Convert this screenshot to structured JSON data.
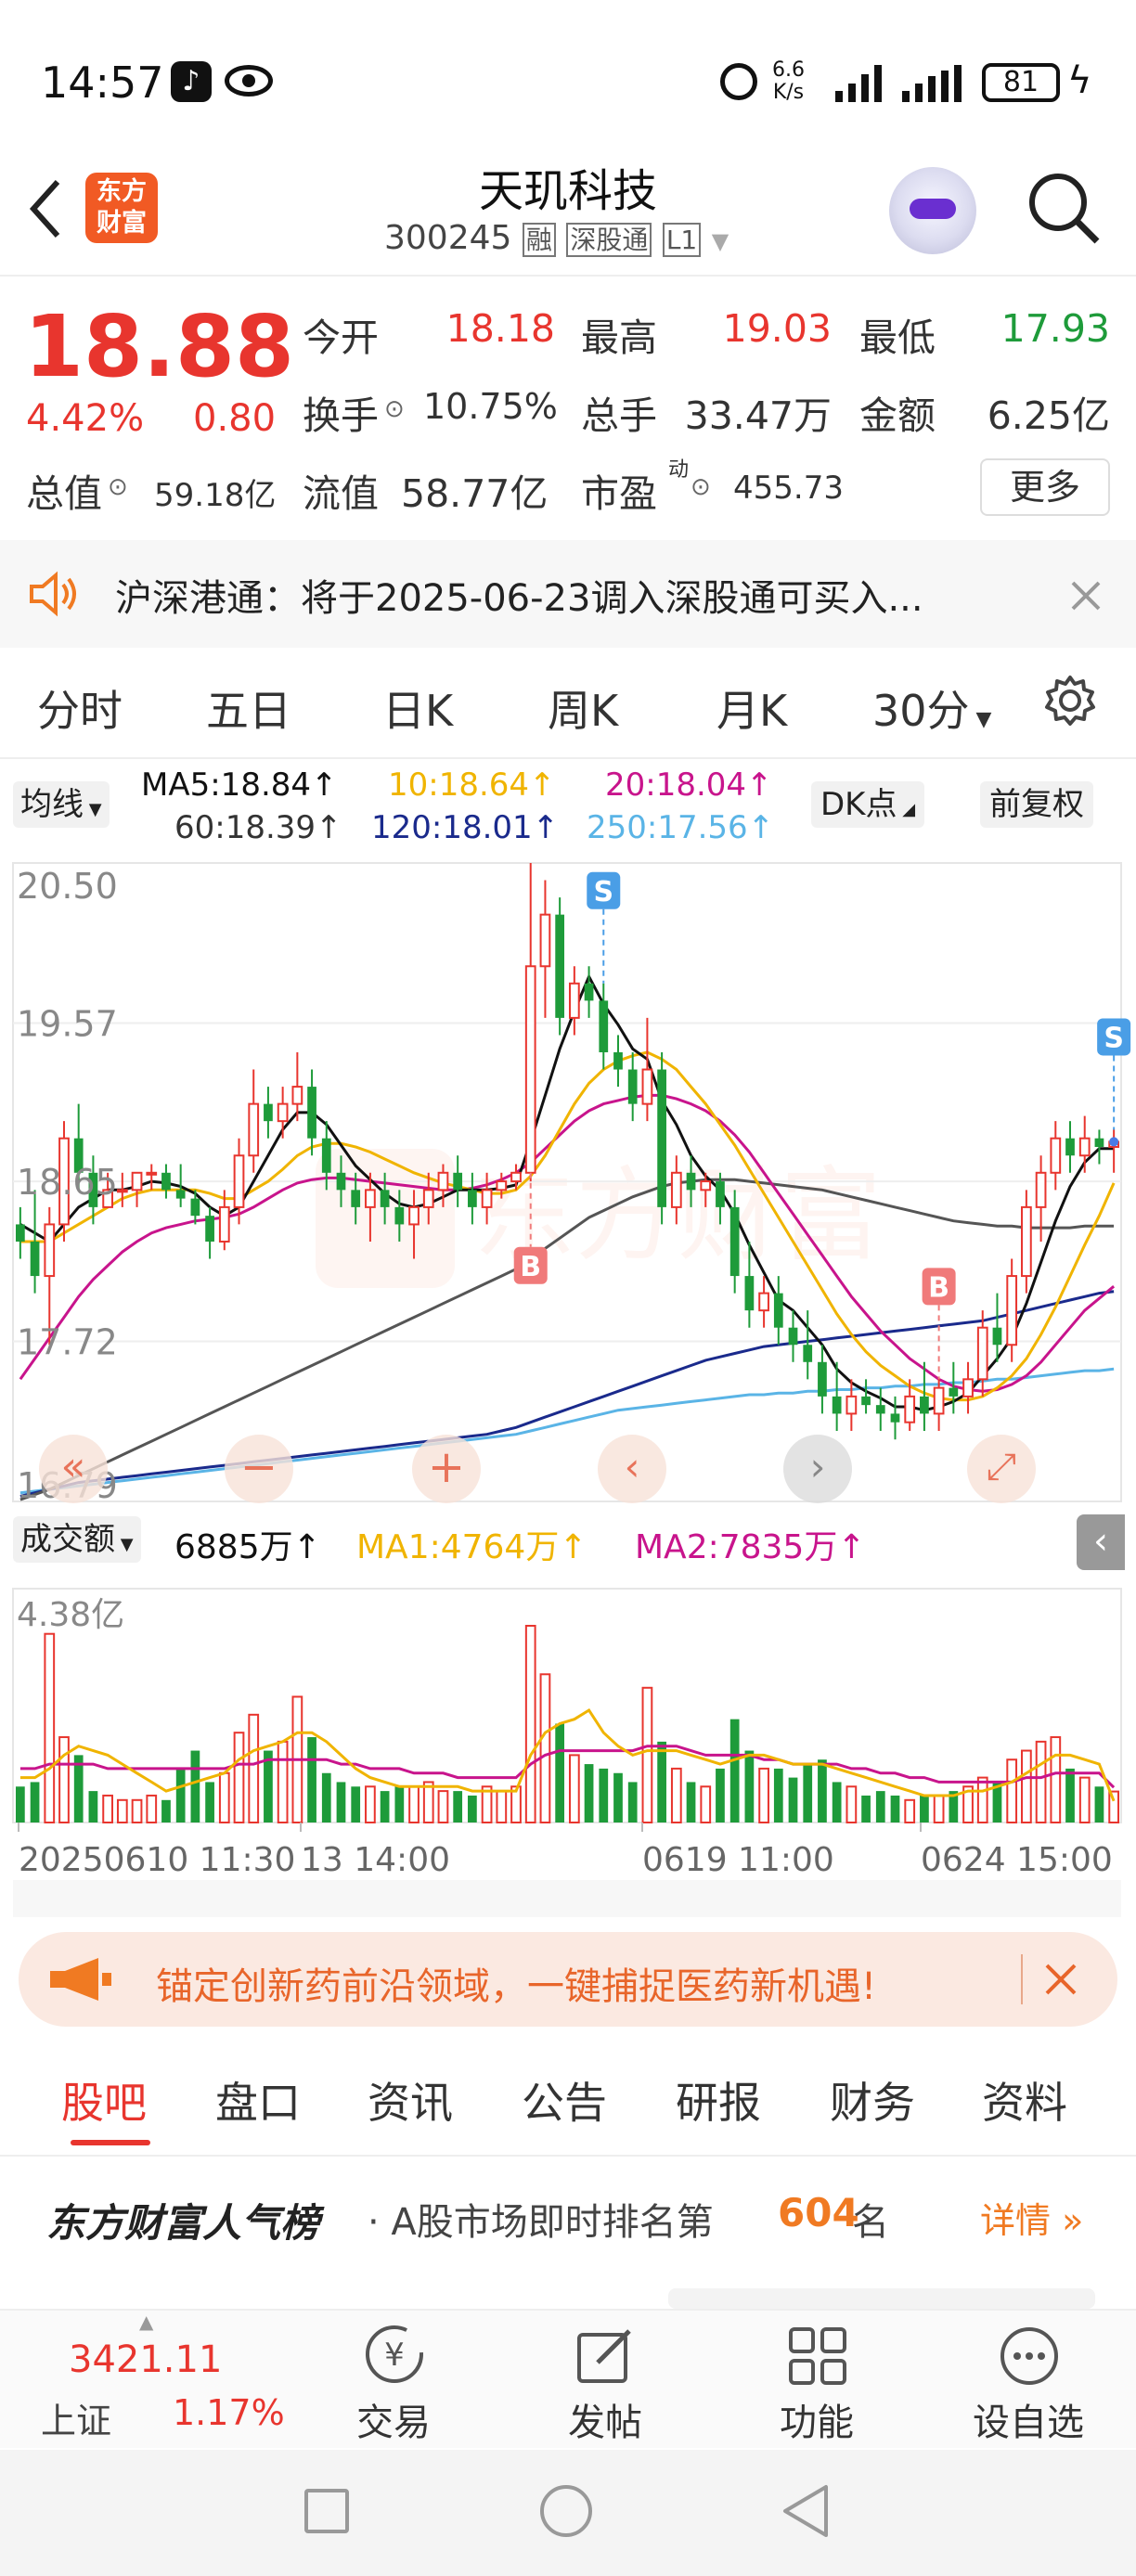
{
  "status_bar": {
    "time": "14:57",
    "net_speed_value": "6.6",
    "net_speed_unit": "K/s",
    "battery": "81"
  },
  "header": {
    "logo_line1": "东方",
    "logo_line2": "财富",
    "title": "天玑科技",
    "code": "300245",
    "tag_rong": "融",
    "tag_sgt": "深股通",
    "tag_l1": "L1"
  },
  "quote": {
    "price": "18.88",
    "change_pct": "4.42%",
    "change": "0.80",
    "open_label": "今开",
    "open": "18.18",
    "high_label": "最高",
    "high": "19.03",
    "low_label": "最低",
    "low": "17.93",
    "turnover_label": "换手",
    "turnover": "10.75%",
    "volume_label": "总手",
    "volume": "33.47万",
    "amount_label": "金额",
    "amount": "6.25亿",
    "mktcap_label": "总值",
    "mktcap": "59.18亿",
    "float_label": "流值",
    "float": "58.77亿",
    "pe_label": "市盈",
    "pe_sup": "动",
    "pe": "455.73",
    "more": "更多"
  },
  "notice": {
    "text": "沪深港通：将于2025-06-23调入深股通可买入..."
  },
  "period_tabs": [
    "分时",
    "五日",
    "日K",
    "周K",
    "月K",
    "30分"
  ],
  "ma_legend": {
    "selector": "均线",
    "ma5": "MA5:18.84↑",
    "ma10": "10:18.64↑",
    "ma20": "20:18.04↑",
    "ma60": "60:18.39↑",
    "ma120": "120:18.01↑",
    "ma250": "250:17.56↑",
    "dk": "DK点",
    "fuquan": "前复权"
  },
  "price_axis": [
    "20.50",
    "19.57",
    "18.65",
    "17.72",
    "16.79"
  ],
  "markers": {
    "s": "S",
    "b": "B"
  },
  "volume_legend": {
    "selector": "成交额",
    "value": "6885万↑",
    "ma1": "MA1:4764万↑",
    "ma2": "MA2:7835万↑",
    "axis_max": "4.38亿"
  },
  "time_axis": [
    "20250610 11:30",
    "13 14:00",
    "0619 11:00",
    "0624 15:00"
  ],
  "ad": {
    "text": "锚定创新药前沿领域，一键捕捉医药新机遇!"
  },
  "sub_tabs": [
    "股吧",
    "盘口",
    "资讯",
    "公告",
    "研报",
    "财务",
    "资料"
  ],
  "rank": {
    "title": "东方财富人气榜",
    "prefix": "· A股市场即时排名第",
    "number": "604",
    "suffix": "名",
    "detail": "详情"
  },
  "bottom_bar": {
    "index_value": "3421.11",
    "index_name": "上证",
    "index_change": "1.17%",
    "trade": "交易",
    "post": "发帖",
    "func": "功能",
    "watch": "设自选"
  },
  "colors": {
    "up": "#e8352e",
    "down": "#1e9b3a",
    "accent": "#f07a22",
    "ma5": "#111111",
    "ma10": "#f0b400",
    "ma20": "#c8148c",
    "ma60": "#555555",
    "ma120": "#1a2a8c",
    "ma250": "#5ab4e6"
  },
  "chart_data": {
    "type": "candlestick",
    "ylim": [
      16.79,
      20.5
    ],
    "candles": [
      [
        18.4,
        18.5,
        18.2,
        18.3
      ],
      [
        18.3,
        18.6,
        18.0,
        18.1
      ],
      [
        18.1,
        18.5,
        17.7,
        18.4
      ],
      [
        18.4,
        19.0,
        18.3,
        18.9
      ],
      [
        18.9,
        19.1,
        18.6,
        18.7
      ],
      [
        18.7,
        18.8,
        18.4,
        18.5
      ],
      [
        18.5,
        18.7,
        18.5,
        18.6
      ],
      [
        18.6,
        18.7,
        18.5,
        18.6
      ],
      [
        18.6,
        18.7,
        18.5,
        18.7
      ],
      [
        18.7,
        18.75,
        18.6,
        18.7
      ],
      [
        18.7,
        18.75,
        18.55,
        18.6
      ],
      [
        18.6,
        18.75,
        18.5,
        18.55
      ],
      [
        18.55,
        18.6,
        18.4,
        18.45
      ],
      [
        18.45,
        18.5,
        18.2,
        18.3
      ],
      [
        18.3,
        18.6,
        18.25,
        18.5
      ],
      [
        18.5,
        18.9,
        18.4,
        18.8
      ],
      [
        18.8,
        19.3,
        18.7,
        19.1
      ],
      [
        19.1,
        19.2,
        18.9,
        19.0
      ],
      [
        19.0,
        19.2,
        18.9,
        19.1
      ],
      [
        19.1,
        19.4,
        19.0,
        19.2
      ],
      [
        19.2,
        19.3,
        18.8,
        18.9
      ],
      [
        18.9,
        19.0,
        18.6,
        18.7
      ],
      [
        18.7,
        18.8,
        18.5,
        18.6
      ],
      [
        18.6,
        18.7,
        18.4,
        18.5
      ],
      [
        18.5,
        18.7,
        18.3,
        18.6
      ],
      [
        18.6,
        18.7,
        18.4,
        18.5
      ],
      [
        18.5,
        18.6,
        18.3,
        18.4
      ],
      [
        18.4,
        18.6,
        18.2,
        18.5
      ],
      [
        18.5,
        18.7,
        18.4,
        18.6
      ],
      [
        18.6,
        18.75,
        18.5,
        18.7
      ],
      [
        18.7,
        18.8,
        18.5,
        18.6
      ],
      [
        18.6,
        18.7,
        18.4,
        18.5
      ],
      [
        18.5,
        18.7,
        18.4,
        18.6
      ],
      [
        18.6,
        18.7,
        18.55,
        18.65
      ],
      [
        18.65,
        18.75,
        18.6,
        18.7
      ],
      [
        18.7,
        20.5,
        18.65,
        19.9
      ],
      [
        19.9,
        20.4,
        19.6,
        20.2
      ],
      [
        20.2,
        20.3,
        19.5,
        19.6
      ],
      [
        19.6,
        19.9,
        19.5,
        19.8
      ],
      [
        19.8,
        19.9,
        19.6,
        19.7
      ],
      [
        19.7,
        19.8,
        19.3,
        19.4
      ],
      [
        19.4,
        19.5,
        19.2,
        19.3
      ],
      [
        19.3,
        19.4,
        19.0,
        19.1
      ],
      [
        19.1,
        19.6,
        19.0,
        19.3
      ],
      [
        19.3,
        19.4,
        18.4,
        18.5
      ],
      [
        18.5,
        18.8,
        18.4,
        18.7
      ],
      [
        18.7,
        18.8,
        18.5,
        18.6
      ],
      [
        18.6,
        18.7,
        18.5,
        18.65
      ],
      [
        18.65,
        18.7,
        18.4,
        18.5
      ],
      [
        18.5,
        18.6,
        18.0,
        18.1
      ],
      [
        18.1,
        18.3,
        17.8,
        17.9
      ],
      [
        17.9,
        18.1,
        17.8,
        18.0
      ],
      [
        18.0,
        18.1,
        17.7,
        17.8
      ],
      [
        17.8,
        17.9,
        17.6,
        17.7
      ],
      [
        17.7,
        17.9,
        17.5,
        17.6
      ],
      [
        17.6,
        17.7,
        17.3,
        17.4
      ],
      [
        17.4,
        17.6,
        17.2,
        17.3
      ],
      [
        17.3,
        17.5,
        17.2,
        17.4
      ],
      [
        17.4,
        17.5,
        17.3,
        17.35
      ],
      [
        17.35,
        17.45,
        17.2,
        17.3
      ],
      [
        17.3,
        17.4,
        17.15,
        17.25
      ],
      [
        17.25,
        17.5,
        17.2,
        17.4
      ],
      [
        17.4,
        17.6,
        17.2,
        17.3
      ],
      [
        17.3,
        17.5,
        17.2,
        17.45
      ],
      [
        17.45,
        17.6,
        17.3,
        17.4
      ],
      [
        17.4,
        17.6,
        17.3,
        17.5
      ],
      [
        17.5,
        17.9,
        17.4,
        17.8
      ],
      [
        17.8,
        18.0,
        17.6,
        17.7
      ],
      [
        17.7,
        18.2,
        17.6,
        18.1
      ],
      [
        18.1,
        18.6,
        18.0,
        18.5
      ],
      [
        18.5,
        18.8,
        18.3,
        18.7
      ],
      [
        18.7,
        19.0,
        18.6,
        18.9
      ],
      [
        18.9,
        19.0,
        18.7,
        18.8
      ],
      [
        18.8,
        19.03,
        18.7,
        18.9
      ],
      [
        18.9,
        18.95,
        18.75,
        18.85
      ],
      [
        18.85,
        18.95,
        18.7,
        18.88
      ]
    ],
    "ma5": [
      18.4,
      18.35,
      18.3,
      18.4,
      18.5,
      18.55,
      18.6,
      18.6,
      18.62,
      18.65,
      18.64,
      18.62,
      18.58,
      18.5,
      18.45,
      18.5,
      18.65,
      18.8,
      18.95,
      19.05,
      19.05,
      18.98,
      18.86,
      18.74,
      18.66,
      18.58,
      18.52,
      18.5,
      18.52,
      18.56,
      18.6,
      18.6,
      18.6,
      18.61,
      18.63,
      18.88,
      19.15,
      19.42,
      19.64,
      19.84,
      19.68,
      19.56,
      19.42,
      19.36,
      19.12,
      18.98,
      18.8,
      18.68,
      18.6,
      18.46,
      18.28,
      18.12,
      17.96,
      17.9,
      17.8,
      17.7,
      17.56,
      17.48,
      17.43,
      17.39,
      17.34,
      17.34,
      17.32,
      17.34,
      17.37,
      17.42,
      17.52,
      17.62,
      17.74,
      17.94,
      18.18,
      18.42,
      18.62,
      18.76,
      18.84,
      18.84
    ],
    "ma10": [
      18.3,
      18.3,
      18.3,
      18.35,
      18.4,
      18.45,
      18.5,
      18.55,
      18.58,
      18.6,
      18.6,
      18.6,
      18.6,
      18.58,
      18.55,
      18.55,
      18.6,
      18.65,
      18.72,
      18.8,
      18.85,
      18.87,
      18.87,
      18.85,
      18.82,
      18.78,
      18.74,
      18.7,
      18.67,
      18.64,
      18.62,
      18.6,
      18.58,
      18.58,
      18.6,
      18.68,
      18.8,
      18.95,
      19.1,
      19.22,
      19.3,
      19.35,
      19.38,
      19.4,
      19.36,
      19.3,
      19.2,
      19.1,
      18.98,
      18.86,
      18.72,
      18.58,
      18.44,
      18.3,
      18.16,
      18.02,
      17.88,
      17.76,
      17.66,
      17.58,
      17.52,
      17.46,
      17.42,
      17.39,
      17.38,
      17.38,
      17.4,
      17.45,
      17.52,
      17.62,
      17.76,
      17.92,
      18.1,
      18.28,
      18.45,
      18.64
    ],
    "ma20": [
      17.5,
      17.62,
      17.74,
      17.86,
      17.98,
      18.08,
      18.16,
      18.24,
      18.3,
      18.35,
      18.38,
      18.4,
      18.42,
      18.43,
      18.44,
      18.46,
      18.5,
      18.55,
      18.6,
      18.64,
      18.66,
      18.67,
      18.67,
      18.66,
      18.65,
      18.64,
      18.63,
      18.62,
      18.61,
      18.6,
      18.6,
      18.61,
      18.63,
      18.66,
      18.7,
      18.76,
      18.84,
      18.92,
      19.0,
      19.06,
      19.1,
      19.12,
      19.14,
      19.15,
      19.15,
      19.13,
      19.1,
      19.06,
      19.0,
      18.92,
      18.82,
      18.7,
      18.58,
      18.46,
      18.34,
      18.22,
      18.1,
      17.98,
      17.88,
      17.78,
      17.7,
      17.62,
      17.56,
      17.5,
      17.46,
      17.44,
      17.43,
      17.44,
      17.47,
      17.52,
      17.6,
      17.7,
      17.8,
      17.9,
      17.97,
      18.04
    ],
    "ma60": [
      16.8,
      16.83,
      16.86,
      16.9,
      16.94,
      16.98,
      17.02,
      17.06,
      17.1,
      17.14,
      17.18,
      17.22,
      17.26,
      17.3,
      17.34,
      17.38,
      17.42,
      17.46,
      17.5,
      17.54,
      17.58,
      17.62,
      17.66,
      17.7,
      17.74,
      17.78,
      17.82,
      17.86,
      17.9,
      17.94,
      17.98,
      18.02,
      18.06,
      18.1,
      18.14,
      18.2,
      18.26,
      18.32,
      18.38,
      18.44,
      18.48,
      18.52,
      18.56,
      18.59,
      18.62,
      18.64,
      18.65,
      18.66,
      18.66,
      18.66,
      18.65,
      18.64,
      18.63,
      18.62,
      18.61,
      18.6,
      18.58,
      18.56,
      18.54,
      18.52,
      18.5,
      18.48,
      18.46,
      18.44,
      18.42,
      18.41,
      18.4,
      18.39,
      18.39,
      18.38,
      18.38,
      18.38,
      18.38,
      18.39,
      18.39,
      18.39
    ],
    "ma120": [
      16.82,
      16.84,
      16.86,
      16.88,
      16.9,
      16.91,
      16.92,
      16.93,
      16.94,
      16.95,
      16.96,
      16.97,
      16.98,
      16.99,
      17.0,
      17.01,
      17.02,
      17.03,
      17.04,
      17.05,
      17.06,
      17.07,
      17.08,
      17.09,
      17.1,
      17.11,
      17.12,
      17.13,
      17.14,
      17.15,
      17.16,
      17.17,
      17.18,
      17.2,
      17.22,
      17.25,
      17.28,
      17.31,
      17.34,
      17.37,
      17.4,
      17.43,
      17.46,
      17.49,
      17.52,
      17.55,
      17.58,
      17.61,
      17.63,
      17.65,
      17.67,
      17.69,
      17.7,
      17.71,
      17.72,
      17.73,
      17.74,
      17.75,
      17.76,
      17.77,
      17.78,
      17.79,
      17.8,
      17.81,
      17.82,
      17.83,
      17.84,
      17.86,
      17.88,
      17.9,
      17.92,
      17.94,
      17.96,
      17.98,
      18.0,
      18.01
    ],
    "ma250": [
      16.84,
      16.85,
      16.86,
      16.87,
      16.88,
      16.89,
      16.9,
      16.91,
      16.92,
      16.93,
      16.94,
      16.95,
      16.96,
      16.97,
      16.98,
      16.99,
      17.0,
      17.01,
      17.02,
      17.03,
      17.04,
      17.05,
      17.06,
      17.07,
      17.08,
      17.09,
      17.1,
      17.11,
      17.12,
      17.13,
      17.14,
      17.15,
      17.16,
      17.17,
      17.18,
      17.2,
      17.22,
      17.24,
      17.26,
      17.28,
      17.3,
      17.32,
      17.33,
      17.34,
      17.35,
      17.36,
      17.37,
      17.38,
      17.39,
      17.4,
      17.41,
      17.41,
      17.42,
      17.42,
      17.43,
      17.43,
      17.44,
      17.44,
      17.45,
      17.45,
      17.46,
      17.46,
      17.47,
      17.47,
      17.48,
      17.48,
      17.49,
      17.5,
      17.5,
      17.51,
      17.52,
      17.53,
      17.54,
      17.55,
      17.55,
      17.56
    ],
    "volume": [
      0.8,
      0.9,
      4.2,
      1.9,
      1.5,
      0.7,
      0.6,
      0.5,
      0.5,
      0.6,
      0.5,
      1.2,
      1.6,
      0.9,
      1.1,
      2.0,
      2.4,
      1.6,
      1.8,
      2.8,
      1.9,
      1.1,
      0.9,
      0.8,
      0.8,
      0.7,
      0.8,
      0.8,
      0.9,
      0.7,
      0.7,
      0.6,
      0.8,
      0.7,
      0.8,
      4.38,
      3.3,
      2.2,
      1.5,
      1.3,
      1.2,
      1.1,
      0.9,
      3.0,
      1.8,
      1.2,
      0.9,
      0.8,
      1.2,
      2.3,
      1.6,
      1.2,
      1.2,
      1.0,
      1.3,
      1.4,
      0.9,
      0.8,
      0.6,
      0.7,
      0.6,
      0.5,
      0.6,
      0.6,
      0.7,
      0.8,
      1.0,
      0.9,
      1.4,
      1.6,
      1.8,
      1.9,
      1.2,
      1.0,
      0.8,
      0.69
    ],
    "vol_ma1": [
      1.0,
      1.0,
      1.2,
      1.5,
      1.7,
      1.6,
      1.5,
      1.3,
      1.1,
      0.9,
      0.7,
      0.8,
      0.9,
      1.0,
      1.1,
      1.4,
      1.6,
      1.7,
      1.8,
      2.0,
      2.0,
      1.8,
      1.5,
      1.2,
      1.0,
      0.9,
      0.8,
      0.8,
      0.8,
      0.8,
      0.8,
      0.7,
      0.7,
      0.7,
      0.7,
      1.5,
      2.0,
      2.2,
      2.3,
      2.5,
      2.0,
      1.7,
      1.5,
      1.6,
      1.6,
      1.6,
      1.5,
      1.4,
      1.3,
      1.4,
      1.5,
      1.5,
      1.4,
      1.3,
      1.3,
      1.3,
      1.2,
      1.1,
      1.0,
      0.9,
      0.8,
      0.7,
      0.6,
      0.6,
      0.6,
      0.7,
      0.7,
      0.8,
      0.9,
      1.1,
      1.3,
      1.5,
      1.5,
      1.4,
      1.3,
      0.48
    ],
    "vol_ma2": [
      1.2,
      1.2,
      1.3,
      1.3,
      1.3,
      1.3,
      1.2,
      1.2,
      1.2,
      1.2,
      1.2,
      1.2,
      1.2,
      1.2,
      1.2,
      1.3,
      1.3,
      1.4,
      1.4,
      1.4,
      1.4,
      1.4,
      1.3,
      1.3,
      1.2,
      1.2,
      1.2,
      1.1,
      1.1,
      1.1,
      1.0,
      1.0,
      1.0,
      1.0,
      1.0,
      1.3,
      1.5,
      1.6,
      1.6,
      1.6,
      1.6,
      1.6,
      1.6,
      1.7,
      1.7,
      1.7,
      1.6,
      1.5,
      1.5,
      1.5,
      1.5,
      1.4,
      1.4,
      1.3,
      1.3,
      1.3,
      1.3,
      1.2,
      1.2,
      1.1,
      1.1,
      1.0,
      1.0,
      0.9,
      0.9,
      0.9,
      0.9,
      0.9,
      0.9,
      1.0,
      1.0,
      1.1,
      1.1,
      1.1,
      1.1,
      0.78
    ]
  }
}
